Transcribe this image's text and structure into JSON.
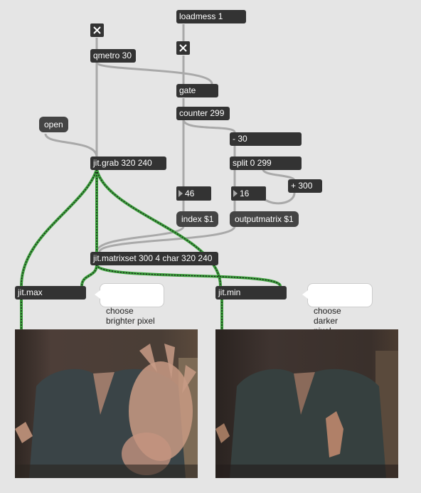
{
  "objects": {
    "loadmess": "loadmess 1",
    "qmetro": "qmetro 30",
    "gate": "gate",
    "counter": "counter 299",
    "minus": "- 30",
    "split": "split 0 299",
    "plus": "+ 300",
    "grab": "jit.grab 320 240",
    "matrixset": "jit.matrixset 300 4 char 320 240",
    "max": "jit.max",
    "min": "jit.min"
  },
  "messages": {
    "open": "open",
    "index": "index $1",
    "outputmatrix": "outputmatrix $1"
  },
  "numbers": {
    "left": "46",
    "right": "16"
  },
  "comments": {
    "max": "choose\nbrighter pixel",
    "min": "choose darker\npixel"
  },
  "colors": {
    "patch_bg": "#e5e5e5",
    "object_bg": "#333333",
    "patchcord": "#a9a9a9",
    "matrix_cord": "#3ca03c"
  },
  "icons": {
    "toggle": "x-toggle-icon",
    "number_arrow": "triangle-right-icon"
  }
}
